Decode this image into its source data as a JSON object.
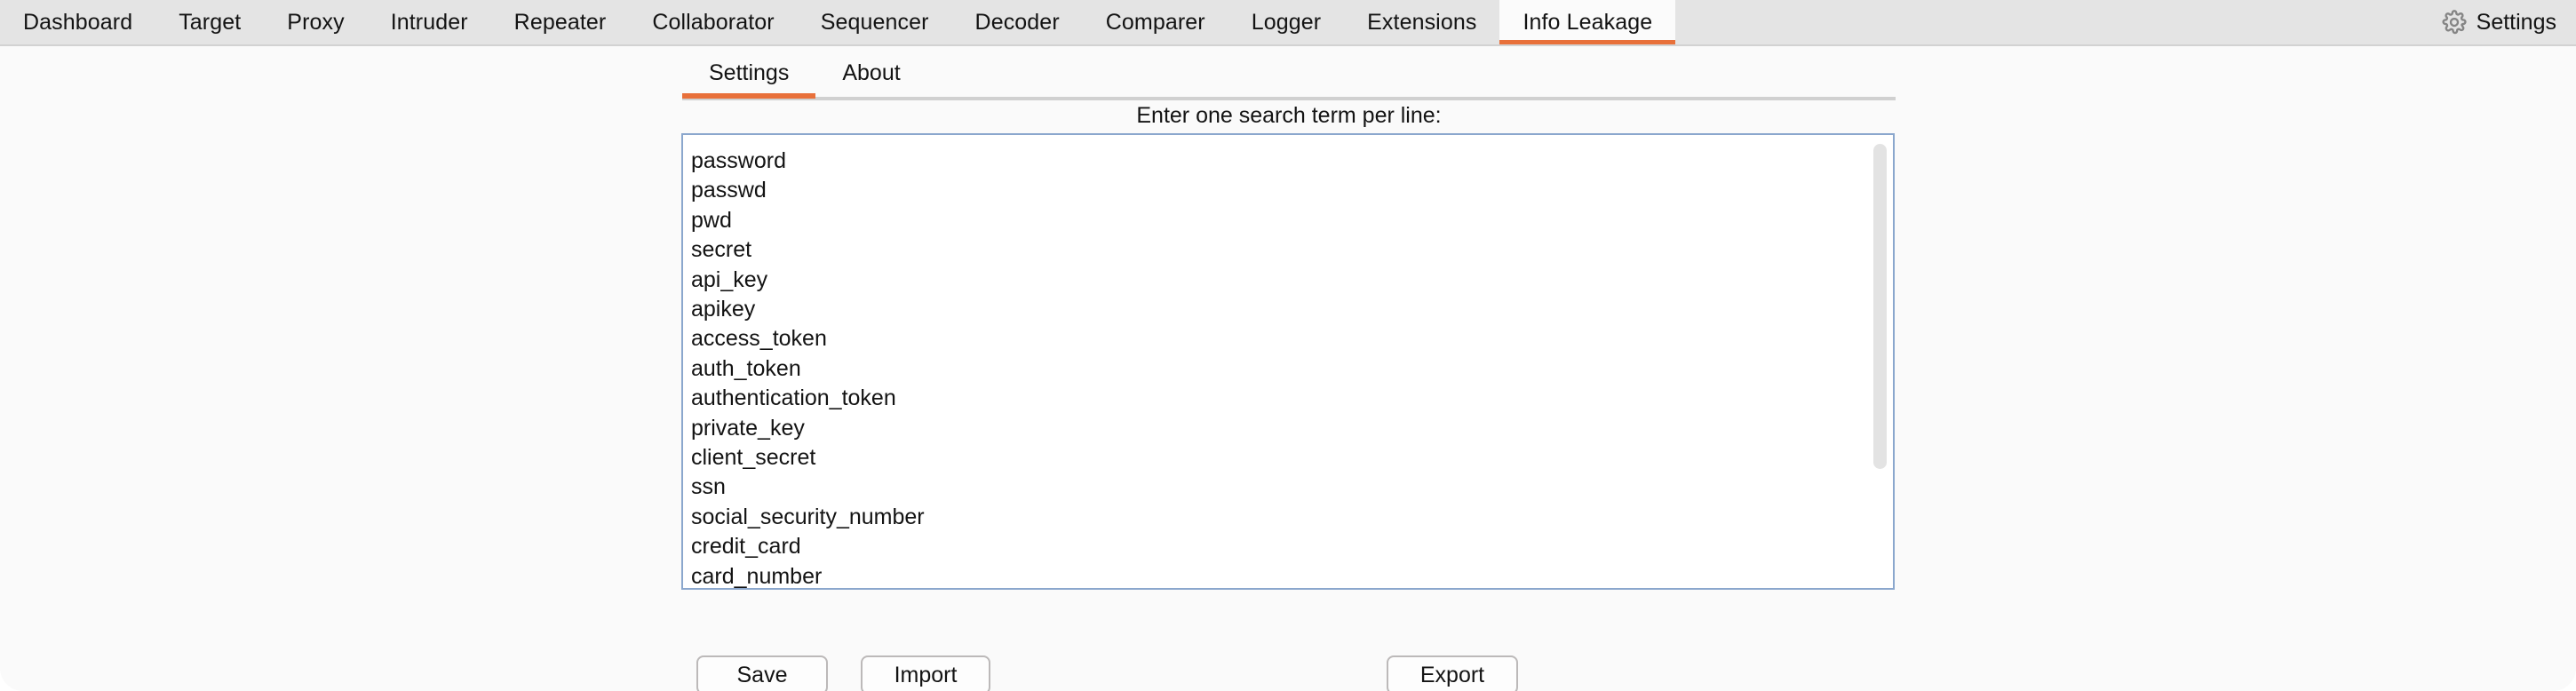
{
  "colors": {
    "accent": "#e8703a",
    "tabbar_bg": "#e4e4e4",
    "panel_bg": "#fafafa",
    "textarea_border": "#8ba7cd",
    "button_border": "#bcb9b9",
    "scrollbar_thumb": "#e3e3e3"
  },
  "top_tabs": [
    {
      "label": "Dashboard",
      "active": false
    },
    {
      "label": "Target",
      "active": false
    },
    {
      "label": "Proxy",
      "active": false
    },
    {
      "label": "Intruder",
      "active": false
    },
    {
      "label": "Repeater",
      "active": false
    },
    {
      "label": "Collaborator",
      "active": false
    },
    {
      "label": "Sequencer",
      "active": false
    },
    {
      "label": "Decoder",
      "active": false
    },
    {
      "label": "Comparer",
      "active": false
    },
    {
      "label": "Logger",
      "active": false
    },
    {
      "label": "Extensions",
      "active": false
    },
    {
      "label": "Info Leakage",
      "active": true
    }
  ],
  "top_tab_labels": {
    "dashboard": "Dashboard",
    "target": "Target",
    "proxy": "Proxy",
    "intruder": "Intruder",
    "repeater": "Repeater",
    "collaborator": "Collaborator",
    "sequencer": "Sequencer",
    "decoder": "Decoder",
    "comparer": "Comparer",
    "logger": "Logger",
    "extensions": "Extensions",
    "info_leakage": "Info Leakage"
  },
  "settings_button": {
    "label": "Settings",
    "icon": "gear-icon"
  },
  "sub_tabs": {
    "settings": "Settings",
    "about": "About",
    "active": "Settings"
  },
  "main": {
    "instruction": "Enter one search term per line:",
    "search_terms": [
      "password",
      "passwd",
      "pwd",
      "secret",
      "api_key",
      "apikey",
      "access_token",
      "auth_token",
      "authentication_token",
      "private_key",
      "client_secret",
      "ssn",
      "social_security_number",
      "credit_card",
      "card_number"
    ],
    "search_terms_text": "password\npasswd\npwd\nsecret\napi_key\napikey\naccess_token\nauth_token\nauthentication_token\nprivate_key\nclient_secret\nssn\nsocial_security_number\ncredit_card\ncard_number"
  },
  "buttons": {
    "save": "Save",
    "import": "Import",
    "export": "Export"
  }
}
